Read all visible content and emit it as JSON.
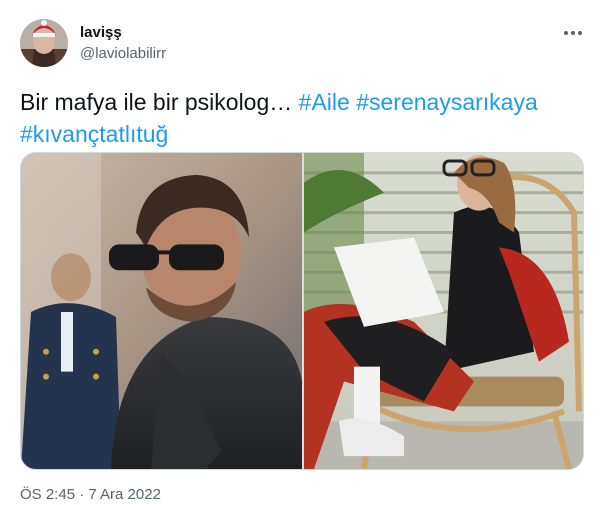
{
  "tweet": {
    "display_name": "lavişş",
    "handle": "@laviolabilirr",
    "text_plain": "Bir mafya ile bir psikolog… ",
    "hashtags": [
      "#Aile",
      "#serenaysarıkaya",
      "#kıvançtatlıtuğ"
    ],
    "timestamp": "ÖS 2:45 · 7 Ara 2022"
  },
  "icons": {
    "more": "more-dots-icon"
  },
  "colors": {
    "hashtag": "#1d9bf0",
    "secondary_text": "#536471",
    "primary_text": "#0f1419"
  }
}
